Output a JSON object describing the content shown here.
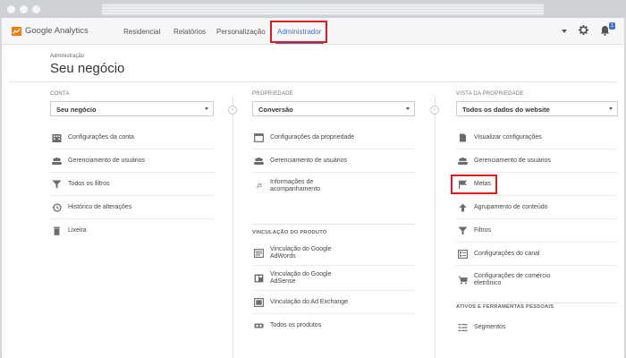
{
  "header": {
    "logo_text": "Google Analytics",
    "nav": [
      {
        "label": "Residencial"
      },
      {
        "label": "Relatórios"
      },
      {
        "label": "Personalização"
      },
      {
        "label": "Administrador"
      }
    ],
    "notification_count": "1",
    "accent_color": "#3b74d9",
    "highlight_color": "#e0191f"
  },
  "page": {
    "breadcrumb": "Administração",
    "title": "Seu negócio"
  },
  "account": {
    "heading": "CONTA",
    "selected": "Seu negócio",
    "items": [
      {
        "label": "Configurações da conta",
        "icon": "building-icon"
      },
      {
        "label": "Gerenciamento de usuários",
        "icon": "users-icon"
      },
      {
        "label": "Todos os filtros",
        "icon": "filter-icon"
      },
      {
        "label": "Histórico de alterações",
        "icon": "history-icon"
      },
      {
        "label": "Lixeira",
        "icon": "trash-icon"
      }
    ]
  },
  "property": {
    "heading": "PROPRIEDADE",
    "selected": "Conversão",
    "items": [
      {
        "label": "Configurações da propriedade",
        "icon": "window-icon"
      },
      {
        "label": "Gerenciamento de usuários",
        "icon": "users-icon"
      },
      {
        "label1": "Informações de",
        "label2": "acompanhamento",
        "icon": "js-icon"
      }
    ],
    "product_heading": "VINCULAÇÃO DO PRODUTO",
    "product_items": [
      {
        "label1": "Vinculação do Google",
        "label2": "AdWords",
        "icon": "adwords-icon"
      },
      {
        "label1": "Vinculação do Google",
        "label2": "AdSense",
        "icon": "adsense-icon"
      },
      {
        "label": "Vinculação do Ad Exchange",
        "icon": "adexchange-icon"
      },
      {
        "label": "Todos os produtos",
        "icon": "link-icon"
      }
    ]
  },
  "view": {
    "heading": "VISTA DA PROPRIEDADE",
    "selected": "Todos os dados do website",
    "items": [
      {
        "label": "Visualizar configurações",
        "icon": "document-icon"
      },
      {
        "label": "Gerenciamento de usuários",
        "icon": "users-icon"
      },
      {
        "label": "Metas",
        "icon": "flag-icon"
      },
      {
        "label": "Agrupamento de conteúdo",
        "icon": "tool-icon"
      },
      {
        "label": "Filtros",
        "icon": "filter-icon"
      },
      {
        "label": "Configurações do canal",
        "icon": "channel-icon"
      },
      {
        "label1": "Configurações de comércio",
        "label2": "eletrônico",
        "icon": "cart-icon"
      }
    ],
    "tools_heading": "ATIVOS E FERRAMENTAS PESSOAIS",
    "tools_items": [
      {
        "label": "Segmentos",
        "icon": "segments-icon"
      }
    ]
  }
}
